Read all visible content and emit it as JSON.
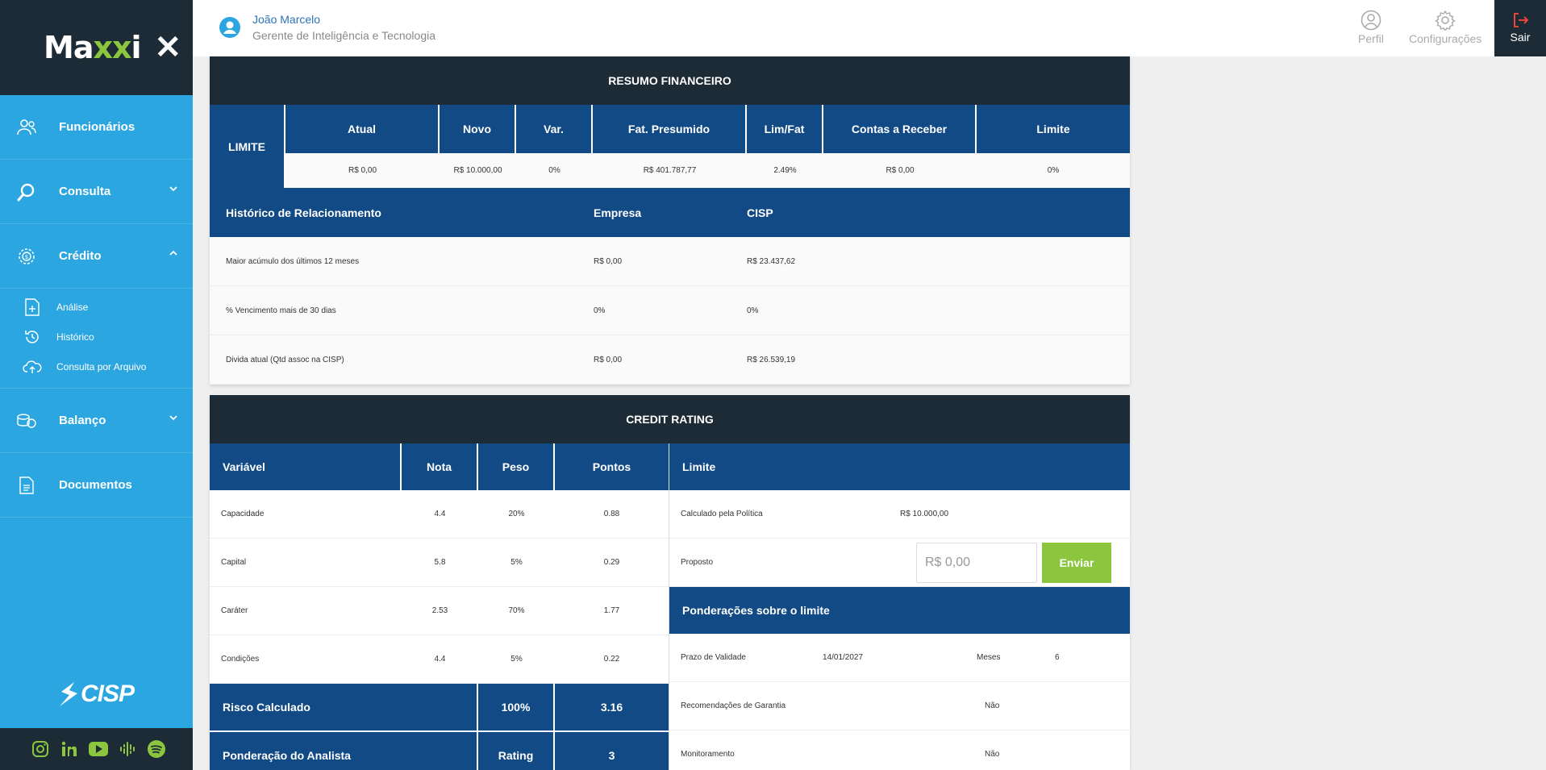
{
  "sidebar": {
    "brand_prefix": "Ma",
    "brand_mid": "xx",
    "brand_suffix": "i",
    "close_glyph": "✕",
    "items": [
      {
        "label": "Funcionários",
        "icon": "users-icon"
      },
      {
        "label": "Consulta",
        "icon": "search-icon"
      },
      {
        "label": "Crédito",
        "icon": "gear-money-icon"
      },
      {
        "label": "Balanço",
        "icon": "coins-icon"
      },
      {
        "label": "Documentos",
        "icon": "document-icon"
      }
    ],
    "credit_subitems": [
      {
        "label": "Análise",
        "icon": "file-plus-icon"
      },
      {
        "label": "Histórico",
        "icon": "history-icon"
      },
      {
        "label": "Consulta por Arquivo",
        "icon": "cloud-upload-icon"
      }
    ],
    "footer_logo": "CISP",
    "social": [
      "instagram-icon",
      "linkedin-icon",
      "youtube-icon",
      "podcast-icon",
      "spotify-icon"
    ]
  },
  "header": {
    "user_name": "João Marcelo",
    "user_role": "Gerente de Inteligência e Tecnologia",
    "profile_label": "Perfil",
    "settings_label": "Configurações",
    "exit_label": "Sair"
  },
  "resumo": {
    "title": "RESUMO FINANCEIRO",
    "limite_label": "LIMITE",
    "columns": [
      "Atual",
      "Novo",
      "Var.",
      "Fat. Presumido",
      "Lim/Fat",
      "Contas a Receber",
      "Limite"
    ],
    "values": [
      "R$ 0,00",
      "R$ 10.000,00",
      "0%",
      "R$ 401.787,77",
      "2.49%",
      "R$ 0,00",
      "0%"
    ]
  },
  "historico": {
    "title": "Histórico de Relacionamento",
    "col_empresa": "Empresa",
    "col_cisp": "CISP",
    "rows": [
      {
        "label": "Maior acúmulo dos últimos 12 meses",
        "empresa": "R$ 0,00",
        "cisp": "R$ 23.437,62"
      },
      {
        "label": "% Vencimento mais de 30 dias",
        "empresa": "0%",
        "cisp": "0%"
      },
      {
        "label": "Divida atual (Qtd assoc na CISP)",
        "empresa": "R$ 0,00",
        "cisp": "R$ 26.539,19"
      }
    ]
  },
  "credit_rating": {
    "title": "CREDIT RATING",
    "headers": {
      "variavel": "Variável",
      "nota": "Nota",
      "peso": "Peso",
      "pontos": "Pontos"
    },
    "rows": [
      {
        "variavel": "Capacidade",
        "nota": "4.4",
        "peso": "20%",
        "pontos": "0.88"
      },
      {
        "variavel": "Capital",
        "nota": "5.8",
        "peso": "5%",
        "pontos": "0.29"
      },
      {
        "variavel": "Caráter",
        "nota": "2.53",
        "peso": "70%",
        "pontos": "1.77"
      },
      {
        "variavel": "Condições",
        "nota": "4.4",
        "peso": "5%",
        "pontos": "0.22"
      }
    ],
    "risco_label": "Risco Calculado",
    "risco_peso": "100%",
    "risco_pontos": "3.16",
    "ponderacao_label": "Ponderação do Analista",
    "ponderacao_col": "Rating",
    "ponderacao_value": "3",
    "limite": {
      "header": "Limite",
      "calc_label": "Calculado pela Política",
      "calc_value": "R$ 10.000,00",
      "proposto_label": "Proposto",
      "proposto_placeholder": "R$ 0,00",
      "send_label": "Enviar"
    },
    "ponderacoes": {
      "header": "Ponderações sobre o limite",
      "prazo_label": "Prazo de Validade",
      "prazo_value": "14/01/2027",
      "meses_label": "Meses",
      "meses_value": "6",
      "garantia_label": "Recomendações de Garantia",
      "garantia_value": "Não",
      "monitor_label": "Monitoramento",
      "monitor_value": "Não"
    }
  },
  "colors": {
    "sidebar_blue": "#2ca6e0",
    "dark": "#1c2b35",
    "table_blue": "#124a85",
    "accent_green": "#8cc63f",
    "exit_red": "#e8453c"
  }
}
